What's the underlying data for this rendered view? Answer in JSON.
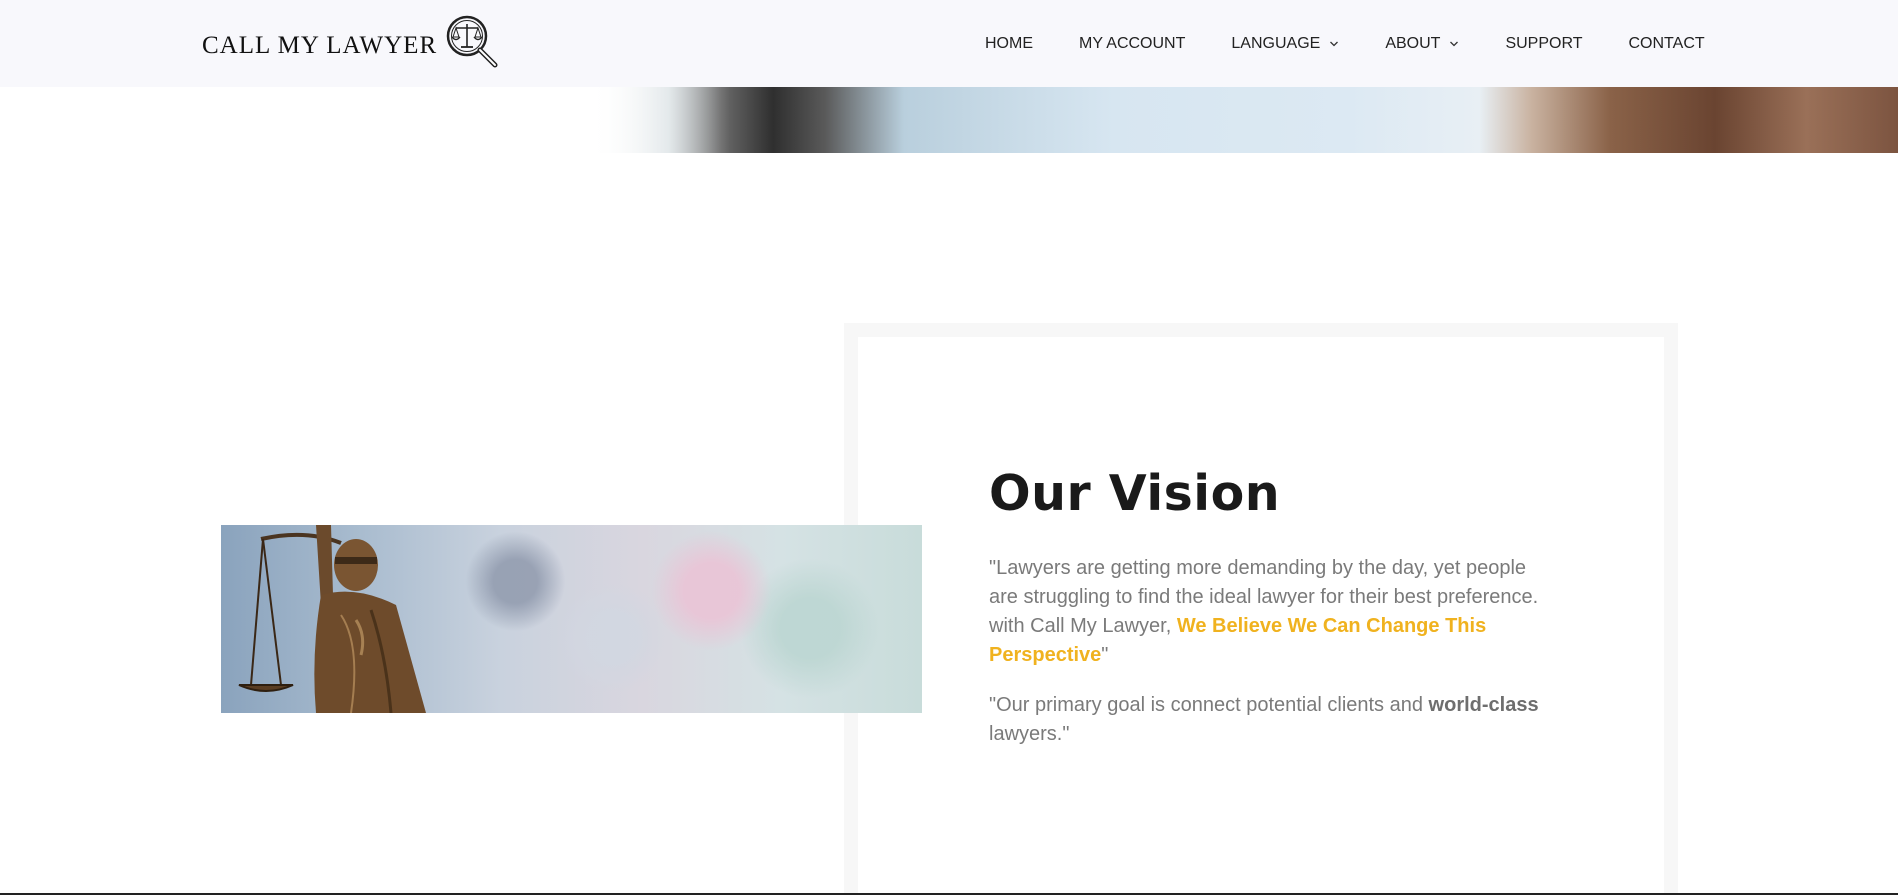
{
  "header": {
    "logo_text": "CALL MY LAWYER",
    "logo_icon": "scales-magnifier-icon",
    "nav": [
      {
        "label": "HOME",
        "has_dropdown": false
      },
      {
        "label": "MY ACCOUNT",
        "has_dropdown": false
      },
      {
        "label": "LANGUAGE",
        "has_dropdown": true
      },
      {
        "label": "ABOUT",
        "has_dropdown": true
      },
      {
        "label": "SUPPORT",
        "has_dropdown": false
      },
      {
        "label": "CONTACT",
        "has_dropdown": false
      }
    ]
  },
  "vision": {
    "title": "Our Vision",
    "p1_before": "\"Lawyers are getting more demanding by the day, yet people are struggling to find the ideal lawyer for their best preference. with Call My Lawyer, ",
    "p1_accent": "We Believe We Can Change This Perspective",
    "p1_after": "\"",
    "p2_before": "\"Our primary goal is connect potential clients and ",
    "p2_strong": "world-class",
    "p2_after": " lawyers.\""
  },
  "colors": {
    "accent": "#f0b21f",
    "header_bg": "#f8f8fc",
    "text_muted": "#7a7a7a",
    "title": "#1a1a1a"
  }
}
